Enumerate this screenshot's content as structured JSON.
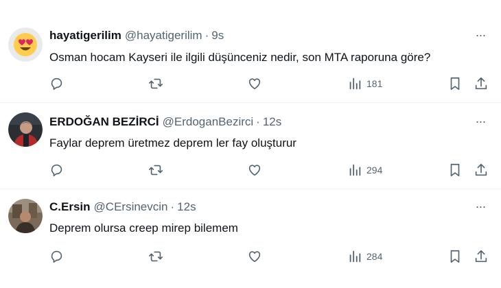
{
  "tweets": [
    {
      "name": "hayatigerilim",
      "handle": "@hayatigerilim",
      "separator": "·",
      "time": "9s",
      "text": "Osman hocam Kayseri ile ilgili düşünceniz nedir, son MTA raporuna göre?",
      "views": "181",
      "avatar": "heart-eyes-emoji"
    },
    {
      "name": "ERDOĞAN BEZİRCİ",
      "handle": "@ErdoganBezirci",
      "separator": "·",
      "time": "12s",
      "text": "Faylar deprem üretmez deprem ler fay oluşturur",
      "views": "294",
      "avatar": "profile-photo"
    },
    {
      "name": "C.Ersin",
      "handle": "@CErsinevcin",
      "separator": "·",
      "time": "12s",
      "text": "Deprem olursa creep mirep bilemem",
      "views": "284",
      "avatar": "profile-photo"
    }
  ],
  "more_label": "···",
  "colors": {
    "text": "#0f1419",
    "secondary": "#536471",
    "divider": "#eff3f4"
  },
  "icons": [
    "reply-icon",
    "retweet-icon",
    "like-icon",
    "views-icon",
    "bookmark-icon",
    "share-icon",
    "more-icon"
  ]
}
